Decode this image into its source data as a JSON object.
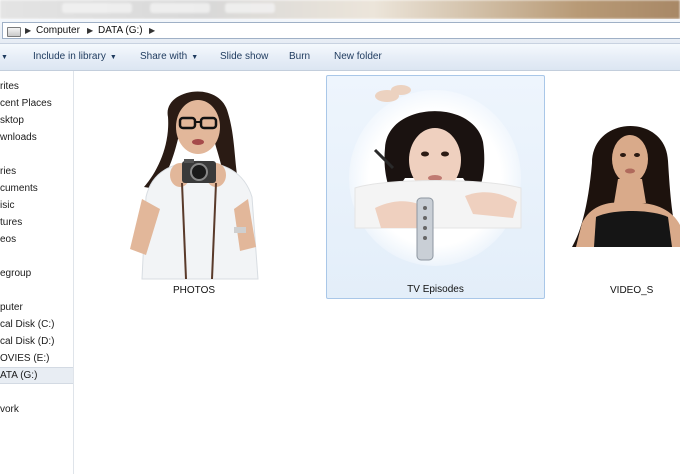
{
  "address": {
    "segments": [
      "Computer",
      "DATA (G:)"
    ]
  },
  "toolbar": {
    "include_library": "Include in library",
    "share_with": "Share with",
    "slide_show": "Slide show",
    "burn": "Burn",
    "new_folder": "New folder"
  },
  "nav": {
    "items": [
      "rites",
      "cent Places",
      "sktop",
      "wnloads",
      "ries",
      "cuments",
      "isic",
      "tures",
      "eos",
      "egroup",
      "puter",
      "cal Disk (C:)",
      "cal Disk (D:)",
      "OVIES (E:)",
      "ATA (G:)",
      "vork"
    ]
  },
  "folders": [
    {
      "label": "PHOTOS"
    },
    {
      "label": "TV Episodes"
    },
    {
      "label": "VIDEO_S"
    }
  ],
  "colors": {
    "selection_fill": "#e3eef9",
    "selection_border": "#a9c7e8",
    "toolbar_text": "#1e3a5e"
  }
}
